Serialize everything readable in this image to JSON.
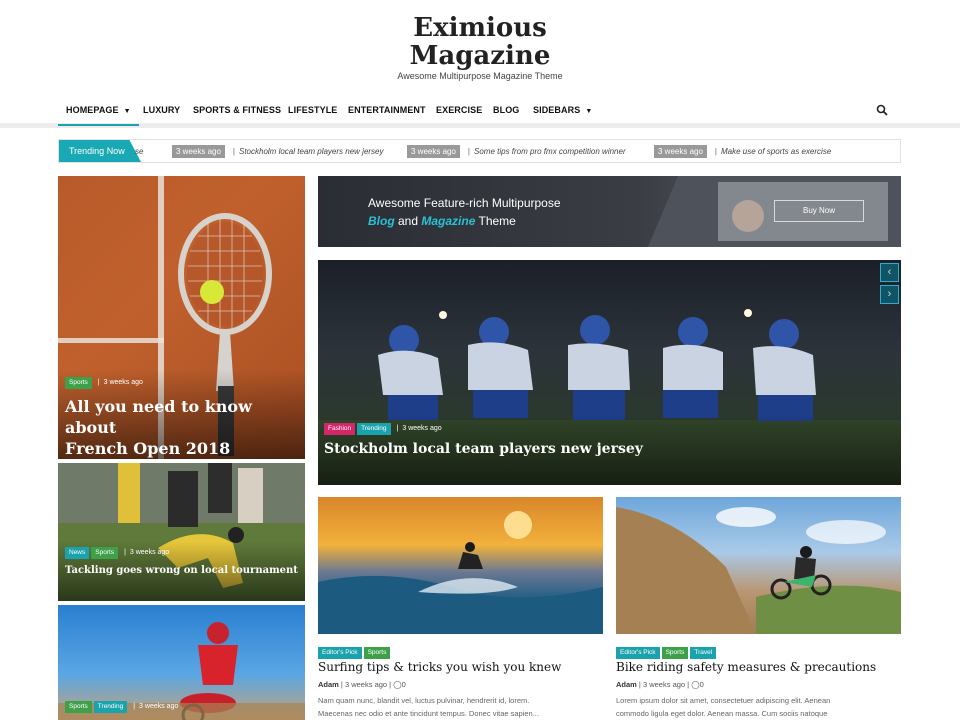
{
  "site": {
    "title_line1": "Eximious",
    "title_line2": "Magazine",
    "tagline": "Awesome Multipurpose Magazine Theme"
  },
  "nav": {
    "items": [
      {
        "label": "HOMEPAGE",
        "has_dropdown": true,
        "active": true
      },
      {
        "label": "LUXURY"
      },
      {
        "label": "SPORTS & FITNESS"
      },
      {
        "label": "LIFESTYLE"
      },
      {
        "label": "ENTERTAINMENT"
      },
      {
        "label": "EXERCISE"
      },
      {
        "label": "BLOG"
      },
      {
        "label": "SIDEBARS",
        "has_dropdown": true
      }
    ],
    "search_icon": "search-icon"
  },
  "trending": {
    "label": "Trending Now",
    "partial": "se",
    "items": [
      {
        "ago": "3 weeks ago",
        "title": "Stockholm local team players new jersey"
      },
      {
        "ago": "3 weeks ago",
        "title": "Some tips from pro fmx competition winner"
      },
      {
        "ago": "3 weeks ago",
        "title": "Make use of sports as exercise"
      }
    ]
  },
  "left_column": [
    {
      "badges": [
        "Sports"
      ],
      "ago": "3 weeks ago",
      "title_line1": "All you need to know about",
      "title_line2": "French Open 2018"
    },
    {
      "badges": [
        "News",
        "Sports"
      ],
      "ago": "3 weeks ago",
      "title": "Tackling goes wrong on local tournament"
    },
    {
      "badges": [
        "Sports",
        "Trending"
      ],
      "ago": "3 weeks ago"
    }
  ],
  "banner": {
    "line1": "Awesome Feature-rich Multipurpose",
    "line2_a": "Blog",
    "line2_b": " and ",
    "line2_c": "Magazine",
    "line2_d": " Theme",
    "button": "Buy Now"
  },
  "slider": {
    "badges": [
      "Fashion",
      "Trending"
    ],
    "ago": "3 weeks ago",
    "title": "Stockholm local team players new jersey",
    "prev_icon": "chevron-left-icon",
    "next_icon": "chevron-right-icon"
  },
  "grid_posts": [
    {
      "badges": [
        "Editor's Pick",
        "Sports"
      ],
      "title": "Surfing tips & tricks you wish you knew",
      "author": "Adam",
      "ago": "3 weeks ago",
      "comments": "0",
      "excerpt1": "Nam quam nunc, blandit vel, luctus pulvinar, hendrerit id, lorem.",
      "excerpt2": "Maecenas nec odio et ante tincidunt tempus. Donec vitae sapien..."
    },
    {
      "badges": [
        "Editor's Pick",
        "Sports",
        "Travel"
      ],
      "title": "Bike riding safety measures & precautions",
      "author": "Adam",
      "ago": "3 weeks ago",
      "comments": "0",
      "excerpt1": "Lorem ipsum dolor sit amet, consectetuer adipiscing elit. Aenean",
      "excerpt2": "commodo ligula eget dolor. Aenean massa. Cum sociis natoque"
    }
  ],
  "colors": {
    "accent": "#19a9b4",
    "badge_green": "#3ea14a",
    "badge_pink": "#d4266b"
  }
}
